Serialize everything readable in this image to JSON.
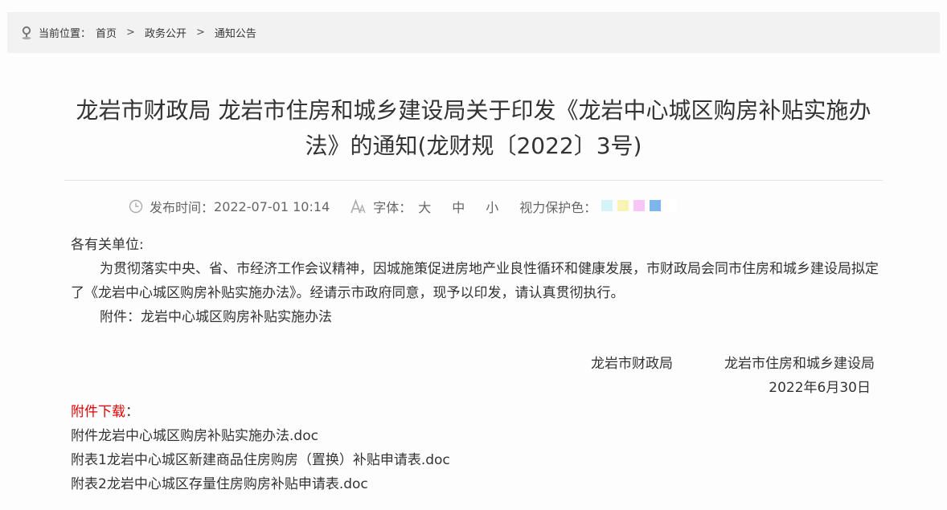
{
  "breadcrumb": {
    "prefix": "当前位置：",
    "items": [
      "首页",
      "通知公告"
    ],
    "separator": ">",
    "middle": "政务公开"
  },
  "article": {
    "title": "龙岩市财政局 龙岩市住房和城乡建设局关于印发《龙岩中心城区购房补贴实施办法》的通知(龙财规〔2022〕3号)",
    "publish_label": "发布时间：",
    "publish_time": "2022-07-01 10:14",
    "font_label": "字体：",
    "font_sizes": [
      "大",
      "中",
      "小"
    ],
    "eye_label": "视力保护色：",
    "eye_colors": [
      "#d4f5f8",
      "#f8f4b4",
      "#f7c6f5",
      "#7eb6ec",
      "#ffffff"
    ],
    "salutation": "各有关单位:",
    "paragraph": "为贯彻落实中央、省、市经济工作会议精神，因城施策促进房地产业良性循环和健康发展，市财政局会同市住房和城乡建设局拟定了《龙岩中心城区购房补贴实施办法》。经请示市政府同意，现予以印发，请认真贯彻执行。",
    "attachment_line": "附件：龙岩中心城区购房补贴实施办法",
    "signer_1": "龙岩市财政局",
    "signer_2": "龙岩市住房和城乡建设局",
    "sign_date": "2022年6月30日",
    "download_label": "附件下载",
    "download_colon": "：",
    "files": [
      "附件龙岩中心城区购房补贴实施办法.doc",
      "附表1龙岩中心城区新建商品住房购房（置换）补贴申请表.doc",
      "附表2龙岩中心城区存量住房购房补贴申请表.doc"
    ]
  }
}
